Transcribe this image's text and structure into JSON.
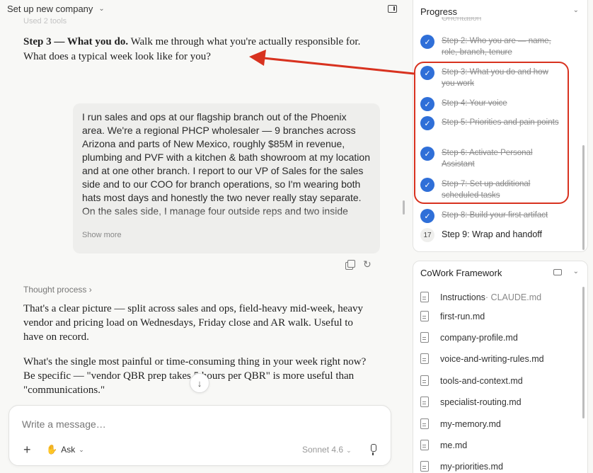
{
  "header": {
    "title": "Set up new company"
  },
  "chat": {
    "faded_label": "Used 2 tools",
    "step_bold": "Step 3 — What you do.",
    "step_text": " Walk me through what you're actually responsible for. What does a typical week look like for you?",
    "user_message": "I run sales and ops at our flagship branch out of the Phoenix area. We're a regional PHCP wholesaler — 9 branches across Arizona and parts of New Mexico, roughly $85M in revenue, plumbing and PVF with a kitchen & bath showroom at my location and at one other branch. I report to our VP of Sales for the sales side and to our COO for branch operations, so I'm wearing both hats most days and honestly the two never really stay separate. On the sales side, I manage four outside reps and two inside",
    "show_more": "Show more",
    "thought_process": "Thought process",
    "reply_1": "That's a clear picture — split across sales and ops, field-heavy mid-week, heavy vendor and pricing load on Wednesdays, Friday close and AR walk. Useful to have on record.",
    "reply_2": "What's the single most painful or time-consuming thing in your week right now? Be specific — \"vendor QBR prep takes 5 hours per QBR\" is more useful than \"communications.\""
  },
  "composer": {
    "placeholder": "Write a message…",
    "mode_label": "Ask",
    "model_label": "Sonnet 4.6"
  },
  "progress": {
    "title": "Progress",
    "cut_item": "Orientation",
    "steps": [
      {
        "label": "Step 2: Who you are — name, role, branch, tenure",
        "done": true
      },
      {
        "label": "Step 3: What you do and how you work",
        "done": true
      },
      {
        "label": "Step 4: Your voice",
        "done": true
      },
      {
        "label": "Step 5: Priorities and pain points",
        "done": true
      },
      {
        "label": "Step 6: Activate Personal Assistant",
        "done": true
      },
      {
        "label": "Step 7: Set up additional scheduled tasks",
        "done": true
      },
      {
        "label": "Step 8: Build your first artifact",
        "done": true
      },
      {
        "label": "Step 9: Wrap and handoff",
        "done": false,
        "number": "17"
      }
    ]
  },
  "files": {
    "title": "CoWork Framework",
    "items": [
      {
        "name": "Instructions",
        "meta": " · CLAUDE.md"
      },
      {
        "name": "first-run.md"
      },
      {
        "name": "company-profile.md"
      },
      {
        "name": "voice-and-writing-rules.md"
      },
      {
        "name": "tools-and-context.md"
      },
      {
        "name": "specialist-routing.md"
      },
      {
        "name": "my-memory.md"
      },
      {
        "name": "me.md"
      },
      {
        "name": "my-priorities.md"
      }
    ]
  },
  "colors": {
    "accent": "#2f6fd8",
    "annotation": "#d8321f"
  }
}
